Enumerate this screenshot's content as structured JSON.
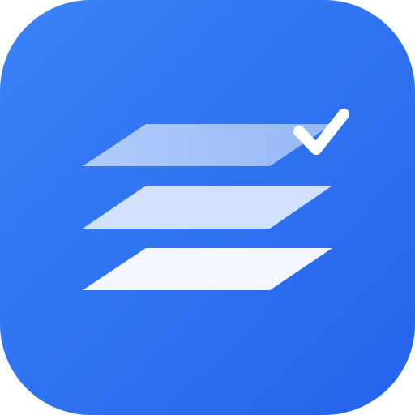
{
  "icon": {
    "name": "stacked-layers-with-check",
    "colors": {
      "background_top_left": "#3A82F7",
      "background_bottom_right": "#2563EB",
      "layer_top": "#A5C3FA",
      "layer_top_light": "#C4D7FC",
      "layer_middle": "#D2E1FD",
      "layer_bottom": "#F4F8FE",
      "check": "#FFFFFF"
    }
  }
}
